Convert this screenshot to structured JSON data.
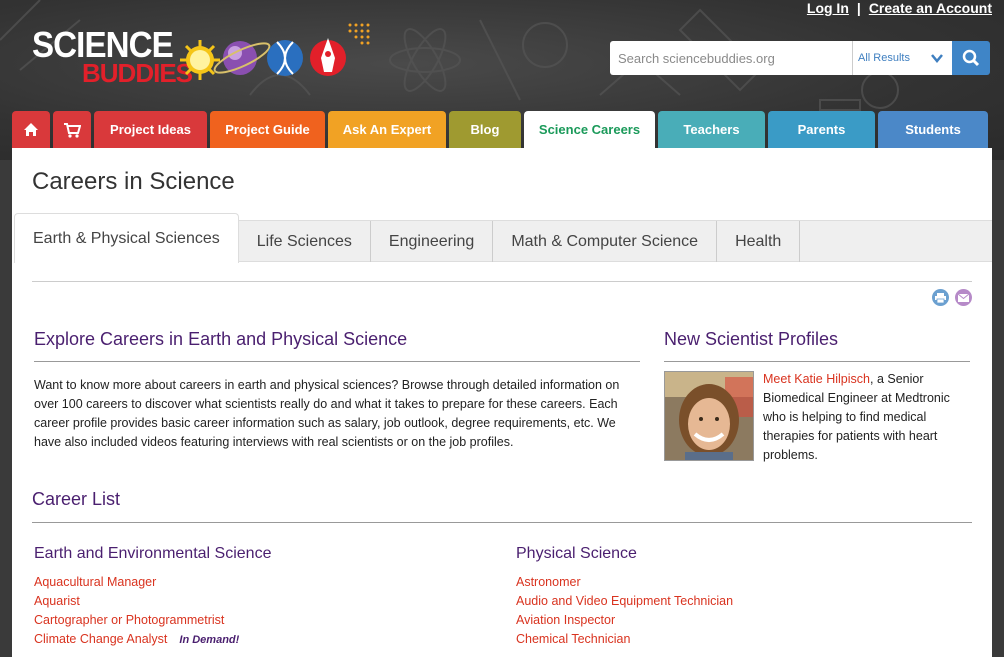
{
  "header": {
    "logo_line1": "SCIENCE",
    "logo_line2": "BUDDIES",
    "login": "Log In",
    "separator": "|",
    "create_account": "Create an Account",
    "search_placeholder": "Search sciencebuddies.org",
    "search_scope": "All Results"
  },
  "nav": {
    "tabs": [
      {
        "label": "",
        "icon": "home-icon",
        "color": "#d9393b"
      },
      {
        "label": "",
        "icon": "cart-icon",
        "color": "#d9393b"
      },
      {
        "label": "Project Ideas",
        "color": "#d9393b"
      },
      {
        "label": "Project Guide",
        "color": "#f0621e"
      },
      {
        "label": "Ask An Expert",
        "color": "#f1a224"
      },
      {
        "label": "Blog",
        "color": "#9f9a30"
      },
      {
        "label": "Science Careers",
        "color": "#1b9a5a",
        "active": true
      },
      {
        "label": "Teachers",
        "color": "#49adb8"
      },
      {
        "label": "Parents",
        "color": "#3a9bc6"
      },
      {
        "label": "Students",
        "color": "#4b88c8"
      }
    ]
  },
  "page": {
    "title": "Careers in Science",
    "subtabs": [
      {
        "label": "Earth & Physical Sciences",
        "active": true
      },
      {
        "label": "Life Sciences"
      },
      {
        "label": "Engineering"
      },
      {
        "label": "Math & Computer Science"
      },
      {
        "label": "Health"
      }
    ]
  },
  "explore": {
    "title": "Explore Careers in Earth and Physical Science",
    "text": "Want to know more about careers in earth and physical sciences? Browse through detailed information on over 100 careers to discover what scientists really do and what it takes to prepare for these careers. Each career profile provides basic career information such as salary, job outlook, degree requirements, etc. We have also included videos featuring interviews with real scientists or on the job profiles."
  },
  "profiles": {
    "title": "New Scientist Profiles",
    "link": "Meet Katie Hilpisch",
    "text": ", a Senior Biomedical Engineer at Medtronic who is helping to find medical therapies for patients with heart problems."
  },
  "career_list": {
    "title": "Career List",
    "columns": [
      {
        "heading": "Earth and Environmental Science",
        "items": [
          {
            "label": "Aquacultural Manager"
          },
          {
            "label": "Aquarist"
          },
          {
            "label": "Cartographer or Photogrammetrist"
          },
          {
            "label": "Climate Change Analyst",
            "badge": "In Demand!"
          }
        ]
      },
      {
        "heading": "Physical Science",
        "items": [
          {
            "label": "Astronomer"
          },
          {
            "label": "Audio and Video Equipment Technician"
          },
          {
            "label": "Aviation Inspector"
          },
          {
            "label": "Chemical Technician"
          }
        ]
      }
    ]
  },
  "colors": {
    "heading_purple": "#4a1f6f",
    "link_red": "#d9331f",
    "active_green": "#1b9a5a"
  }
}
